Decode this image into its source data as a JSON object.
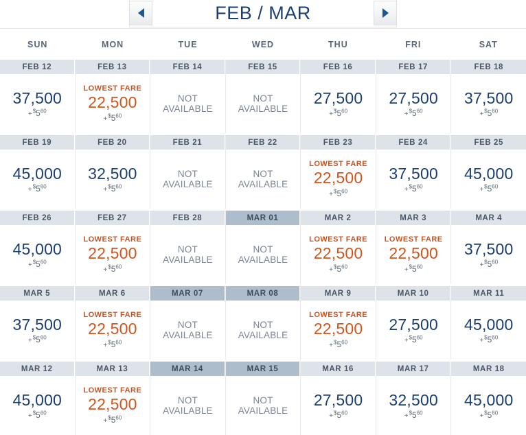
{
  "header": {
    "title": "FEB / MAR",
    "prev_icon": "triangle-left-icon",
    "next_icon": "triangle-right-icon"
  },
  "weekdays": [
    "SUN",
    "MON",
    "TUE",
    "WED",
    "THU",
    "FRI",
    "SAT"
  ],
  "labels": {
    "lowest_fare": "LOWEST FARE",
    "not_available": "NOT AVAILABLE",
    "tax_plus": "+",
    "tax_currency": "$",
    "tax_dollars": "5",
    "tax_cents": "60"
  },
  "colors": {
    "title": "#1b3f73",
    "miles": "#1b3f73",
    "lowest": "#d4541b",
    "lowest_label": "#c8521f",
    "date_band": "#dde3e9",
    "date_band_highlight": "#aebdcc",
    "not_available": "#7b8394"
  },
  "weeks": [
    {
      "days": [
        {
          "date": "FEB 12",
          "highlight": false,
          "available": true,
          "lowest": false,
          "miles": "37,500"
        },
        {
          "date": "FEB 13",
          "highlight": false,
          "available": true,
          "lowest": true,
          "miles": "22,500"
        },
        {
          "date": "FEB 14",
          "highlight": false,
          "available": false,
          "lowest": false,
          "miles": ""
        },
        {
          "date": "FEB 15",
          "highlight": false,
          "available": false,
          "lowest": false,
          "miles": ""
        },
        {
          "date": "FEB 16",
          "highlight": false,
          "available": true,
          "lowest": false,
          "miles": "27,500"
        },
        {
          "date": "FEB 17",
          "highlight": false,
          "available": true,
          "lowest": false,
          "miles": "27,500"
        },
        {
          "date": "FEB 18",
          "highlight": false,
          "available": true,
          "lowest": false,
          "miles": "37,500"
        }
      ]
    },
    {
      "days": [
        {
          "date": "FEB 19",
          "highlight": false,
          "available": true,
          "lowest": false,
          "miles": "45,000"
        },
        {
          "date": "FEB 20",
          "highlight": false,
          "available": true,
          "lowest": false,
          "miles": "32,500"
        },
        {
          "date": "FEB 21",
          "highlight": false,
          "available": false,
          "lowest": false,
          "miles": ""
        },
        {
          "date": "FEB 22",
          "highlight": false,
          "available": false,
          "lowest": false,
          "miles": ""
        },
        {
          "date": "FEB 23",
          "highlight": false,
          "available": true,
          "lowest": true,
          "miles": "22,500"
        },
        {
          "date": "FEB 24",
          "highlight": false,
          "available": true,
          "lowest": false,
          "miles": "37,500"
        },
        {
          "date": "FEB 25",
          "highlight": false,
          "available": true,
          "lowest": false,
          "miles": "45,000"
        }
      ]
    },
    {
      "days": [
        {
          "date": "FEB 26",
          "highlight": false,
          "available": true,
          "lowest": false,
          "miles": "45,000"
        },
        {
          "date": "FEB 27",
          "highlight": false,
          "available": true,
          "lowest": true,
          "miles": "22,500"
        },
        {
          "date": "FEB 28",
          "highlight": false,
          "available": false,
          "lowest": false,
          "miles": ""
        },
        {
          "date": "MAR 01",
          "highlight": true,
          "available": false,
          "lowest": false,
          "miles": ""
        },
        {
          "date": "MAR 2",
          "highlight": false,
          "available": true,
          "lowest": true,
          "miles": "22,500"
        },
        {
          "date": "MAR 3",
          "highlight": false,
          "available": true,
          "lowest": true,
          "miles": "22,500"
        },
        {
          "date": "MAR 4",
          "highlight": false,
          "available": true,
          "lowest": false,
          "miles": "37,500"
        }
      ]
    },
    {
      "days": [
        {
          "date": "MAR 5",
          "highlight": false,
          "available": true,
          "lowest": false,
          "miles": "37,500"
        },
        {
          "date": "MAR 6",
          "highlight": false,
          "available": true,
          "lowest": true,
          "miles": "22,500"
        },
        {
          "date": "MAR 07",
          "highlight": true,
          "available": false,
          "lowest": false,
          "miles": ""
        },
        {
          "date": "MAR 08",
          "highlight": true,
          "available": false,
          "lowest": false,
          "miles": ""
        },
        {
          "date": "MAR 9",
          "highlight": false,
          "available": true,
          "lowest": true,
          "miles": "22,500"
        },
        {
          "date": "MAR 10",
          "highlight": false,
          "available": true,
          "lowest": false,
          "miles": "27,500"
        },
        {
          "date": "MAR 11",
          "highlight": false,
          "available": true,
          "lowest": false,
          "miles": "45,000"
        }
      ]
    },
    {
      "days": [
        {
          "date": "MAR 12",
          "highlight": false,
          "available": true,
          "lowest": false,
          "miles": "45,000"
        },
        {
          "date": "MAR 13",
          "highlight": false,
          "available": true,
          "lowest": true,
          "miles": "22,500"
        },
        {
          "date": "MAR 14",
          "highlight": true,
          "available": false,
          "lowest": false,
          "miles": ""
        },
        {
          "date": "MAR 15",
          "highlight": true,
          "available": false,
          "lowest": false,
          "miles": ""
        },
        {
          "date": "MAR 16",
          "highlight": false,
          "available": true,
          "lowest": false,
          "miles": "27,500"
        },
        {
          "date": "MAR 17",
          "highlight": false,
          "available": true,
          "lowest": false,
          "miles": "32,500"
        },
        {
          "date": "MAR 18",
          "highlight": false,
          "available": true,
          "lowest": false,
          "miles": "45,000"
        }
      ]
    }
  ]
}
